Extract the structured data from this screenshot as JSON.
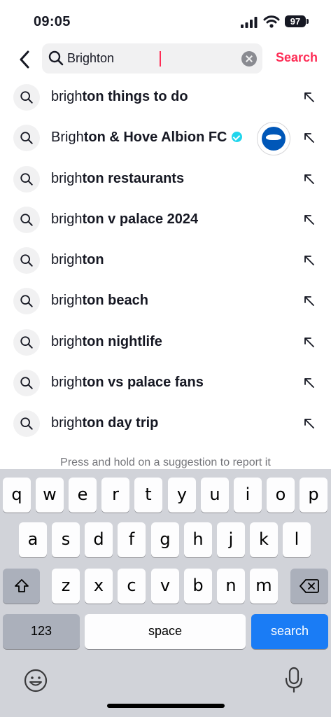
{
  "status_bar": {
    "time": "09:05",
    "battery": "97"
  },
  "search": {
    "query": "Brighton",
    "action_label": "Search"
  },
  "suggestions": [
    {
      "match": "brigh",
      "rest": "ton things to do"
    },
    {
      "match": "Brigh",
      "rest": "ton & Hove Albion FC",
      "verified": true
    },
    {
      "match": "brigh",
      "rest": "ton restaurants"
    },
    {
      "match": "brigh",
      "rest": "ton v palace 2024"
    },
    {
      "match": "brigh",
      "rest": "ton"
    },
    {
      "match": "brigh",
      "rest": "ton beach"
    },
    {
      "match": "brigh",
      "rest": "ton nightlife"
    },
    {
      "match": "brigh",
      "rest": "ton vs palace fans"
    },
    {
      "match": "brigh",
      "rest": "ton day trip"
    }
  ],
  "report_hint": "Press and hold on a suggestion to report it",
  "keyboard": {
    "row1": [
      "q",
      "w",
      "e",
      "r",
      "t",
      "y",
      "u",
      "i",
      "o",
      "p"
    ],
    "row2": [
      "a",
      "s",
      "d",
      "f",
      "g",
      "h",
      "j",
      "k",
      "l"
    ],
    "row3": [
      "z",
      "x",
      "c",
      "v",
      "b",
      "n",
      "m"
    ],
    "numbers_label": "123",
    "space_label": "space",
    "return_label": "search"
  },
  "icons": {
    "back": "chevron-left-icon",
    "search": "magnifier-icon",
    "clear": "clear-x-icon",
    "fill_arrow": "arrow-up-left-icon",
    "verified": "verified-badge-icon",
    "shift": "shift-icon",
    "delete": "backspace-icon",
    "emoji": "emoji-icon",
    "mic": "microphone-icon"
  },
  "colors": {
    "accent": "#fe2c55",
    "verified": "#20d5ec",
    "keyboard_go": "#1a7cf5"
  }
}
